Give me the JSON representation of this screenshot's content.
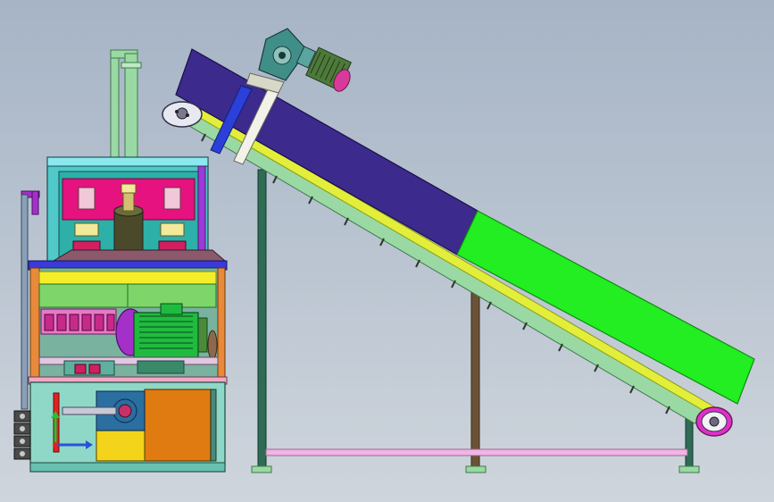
{
  "scene": {
    "description_text": "",
    "colors": {
      "background_top": "#a6b4c6",
      "background_bottom": "#cfd5dc",
      "conveyor_cover": "#3c2a8c",
      "conveyor_cover_end": "#22ee22",
      "frame_post": "#2f6b55",
      "frame_post_mid": "#6b5236",
      "base_rail": "#f2b4e4",
      "chute_pipe": "#9ad9a3",
      "motor_housing": "#1fbb3f",
      "motor_endcap": "#a52fc9",
      "tank_orange": "#e07b12",
      "tank_yellow": "#f3d41b",
      "pump_blue": "#2b6ea0",
      "panel_magenta": "#e5127f",
      "panel_green": "#7ed66b",
      "gearbox_teal": "#3f8f88",
      "axis_red": "#e52020",
      "axis_blue": "#2a52d8",
      "axis_green": "#2bbf32"
    },
    "icons": [
      "motor-icon",
      "gearbox-icon",
      "pulley-icon",
      "axis-triad-icon"
    ]
  }
}
